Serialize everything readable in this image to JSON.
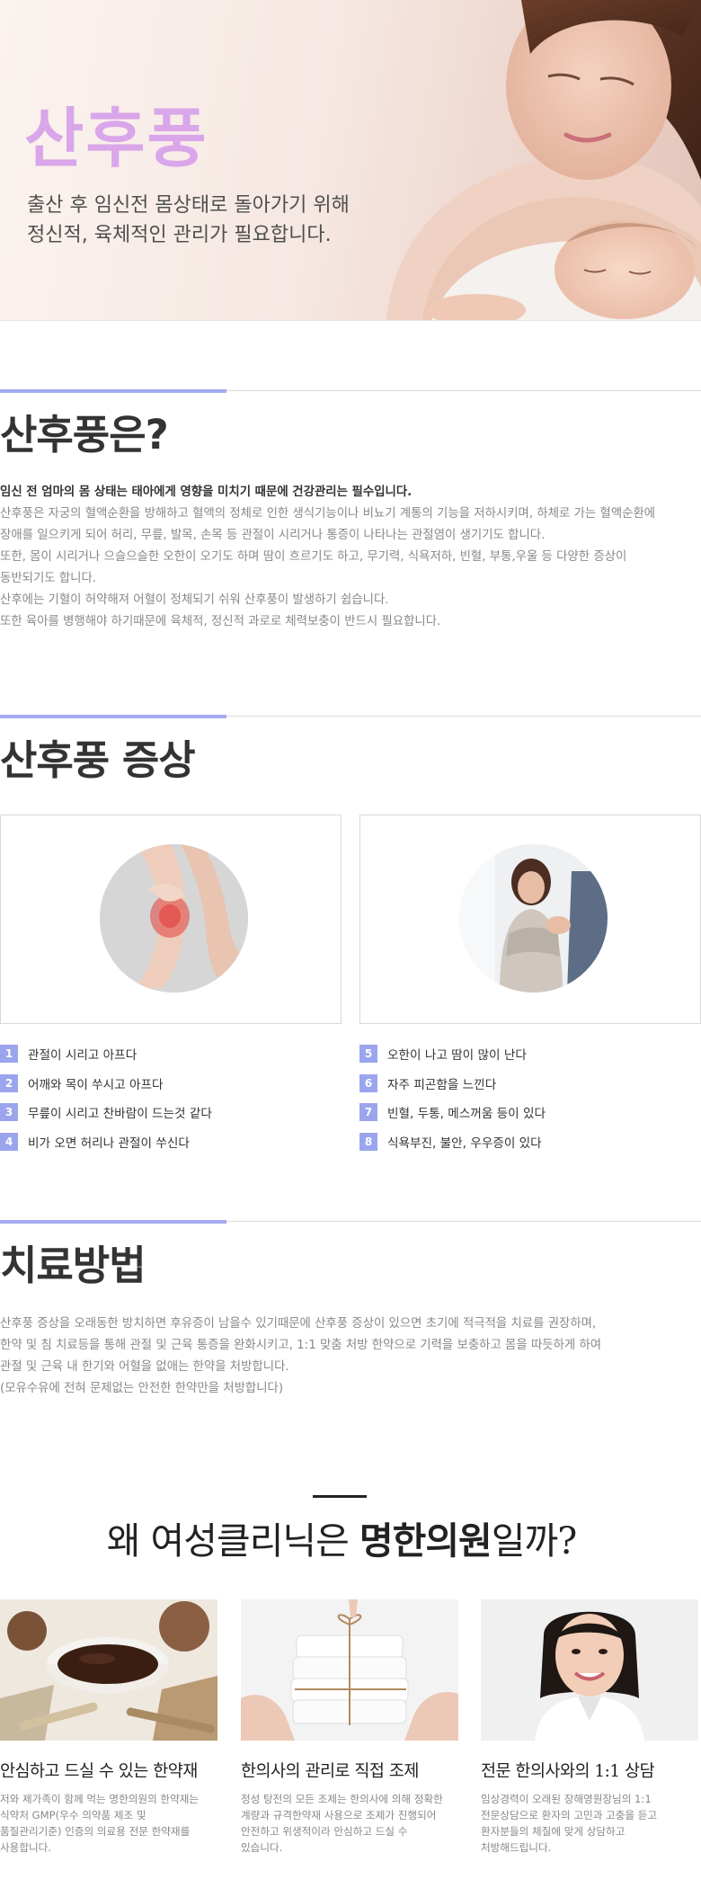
{
  "hero": {
    "title": "산후풍",
    "subtitle_lines": [
      "출산 후 임신전 몸상태로 돌아가기 위해",
      "정신적, 육체적인 관리가 필요합니다."
    ]
  },
  "about": {
    "title": "산후풍은?",
    "lead": "임신 전 엄마의 몸 상태는 태아에게 영향을 미치기 때문에 건강관리는 필수입니다.",
    "lines": [
      "산후풍은 자궁의 혈액순환을 방해하고 혈액의 정체로 인한 생식기능이나 비뇨기 계통의 기능을 저하시키며, 하체로 가는 혈액순환에",
      "장애를 일으키게 되어 허리, 무릎, 발목, 손목 등 관절이 시리거나 통증이 나타나는 관절염이 생기기도 합니다.",
      "또한, 몸이 시리거나 으슬으슬한 오한이 오기도 하며 땀이 흐르기도 하고, 무기력, 식욕저하, 빈혈, 부통,우울 등 다양한 증상이",
      "동반되기도 합니다.",
      "산후에는 기혈이 허약해져 어혈이 정체되기 쉬워 산후풍이 발생하기 쉽습니다.",
      "또한 육아를 병행해야 하기때문에 육체적, 정신적 과로로 체력보충이 반드시 필요합니다."
    ]
  },
  "symptoms": {
    "title": "산후풍 증상",
    "left": [
      {
        "num": "1",
        "text": "관절이 시리고 아프다"
      },
      {
        "num": "2",
        "text": "어깨와 목이 쑤시고 아프다"
      },
      {
        "num": "3",
        "text": "무릎이 시리고 찬바람이 드는것 같다"
      },
      {
        "num": "4",
        "text": "비가 오면 허리나 관절이 쑤신다"
      }
    ],
    "right": [
      {
        "num": "5",
        "text": "오한이 나고 땀이 많이 난다"
      },
      {
        "num": "6",
        "text": "자주 피곤함을 느낀다"
      },
      {
        "num": "7",
        "text": "빈혈, 두통, 메스꺼움 등이 있다"
      },
      {
        "num": "8",
        "text": "식욕부진, 불안, 우우증이 있다"
      }
    ]
  },
  "treatment": {
    "title": "치료방법",
    "lines": [
      "산후풍 증상을 오래동한 방치하면 후유증이 남을수 있기때문에 산후풍 증상이 있으면 초기에 적극적을 치료를 권장하며,",
      "한약 및 침 치료등을 통해 관절 및 근육 통증을 완화시키고, 1:1 맞춤 처방 한약으로 기력을 보충하고 몸을 따듯하게 하여",
      "관절 및 근육 내 한기와 어혈을 없애는 한약을 처방합니다.",
      "(모유수유에 전혀 문제없는 안전한 한약만을 처방합니다)"
    ]
  },
  "why": {
    "title_prefix": "왜 여성클리닉은 ",
    "title_bold": "명한의원",
    "title_suffix": "일까?",
    "features": [
      {
        "title": "안심하고 드실 수 있는 한약재",
        "lines": [
          "저와 제가족이 함께 먹는 명한의원의 한약재는",
          "식약처 GMP(우수 의약품 제조 및",
          "품질관리기준) 인증의 의료용 전문 한약재를",
          "사용합니다."
        ]
      },
      {
        "title": "한의사의 관리로 직접 조제",
        "lines": [
          "정성 탕전의 모든 조제는 한의사에 의해 정확한",
          "계량과 규격한약재 사용으로 조제가 진행되어",
          "안전하고 위생적이라 안심하고 드실 수",
          "있습니다."
        ]
      },
      {
        "title": "전문 한의사와의 1:1 상담",
        "lines": [
          "임상경력이 오래된 장해영원장님의 1:1",
          "전문상담으로 환자의 고민과 고충을 듣고",
          "환자분들의 체질에 맞게 상담하고",
          "처방해드립니다."
        ]
      }
    ]
  },
  "colors": {
    "accent": "#a3abf2",
    "hero_title": "#d9a6ea",
    "number_badge": "#9ba5ee"
  }
}
